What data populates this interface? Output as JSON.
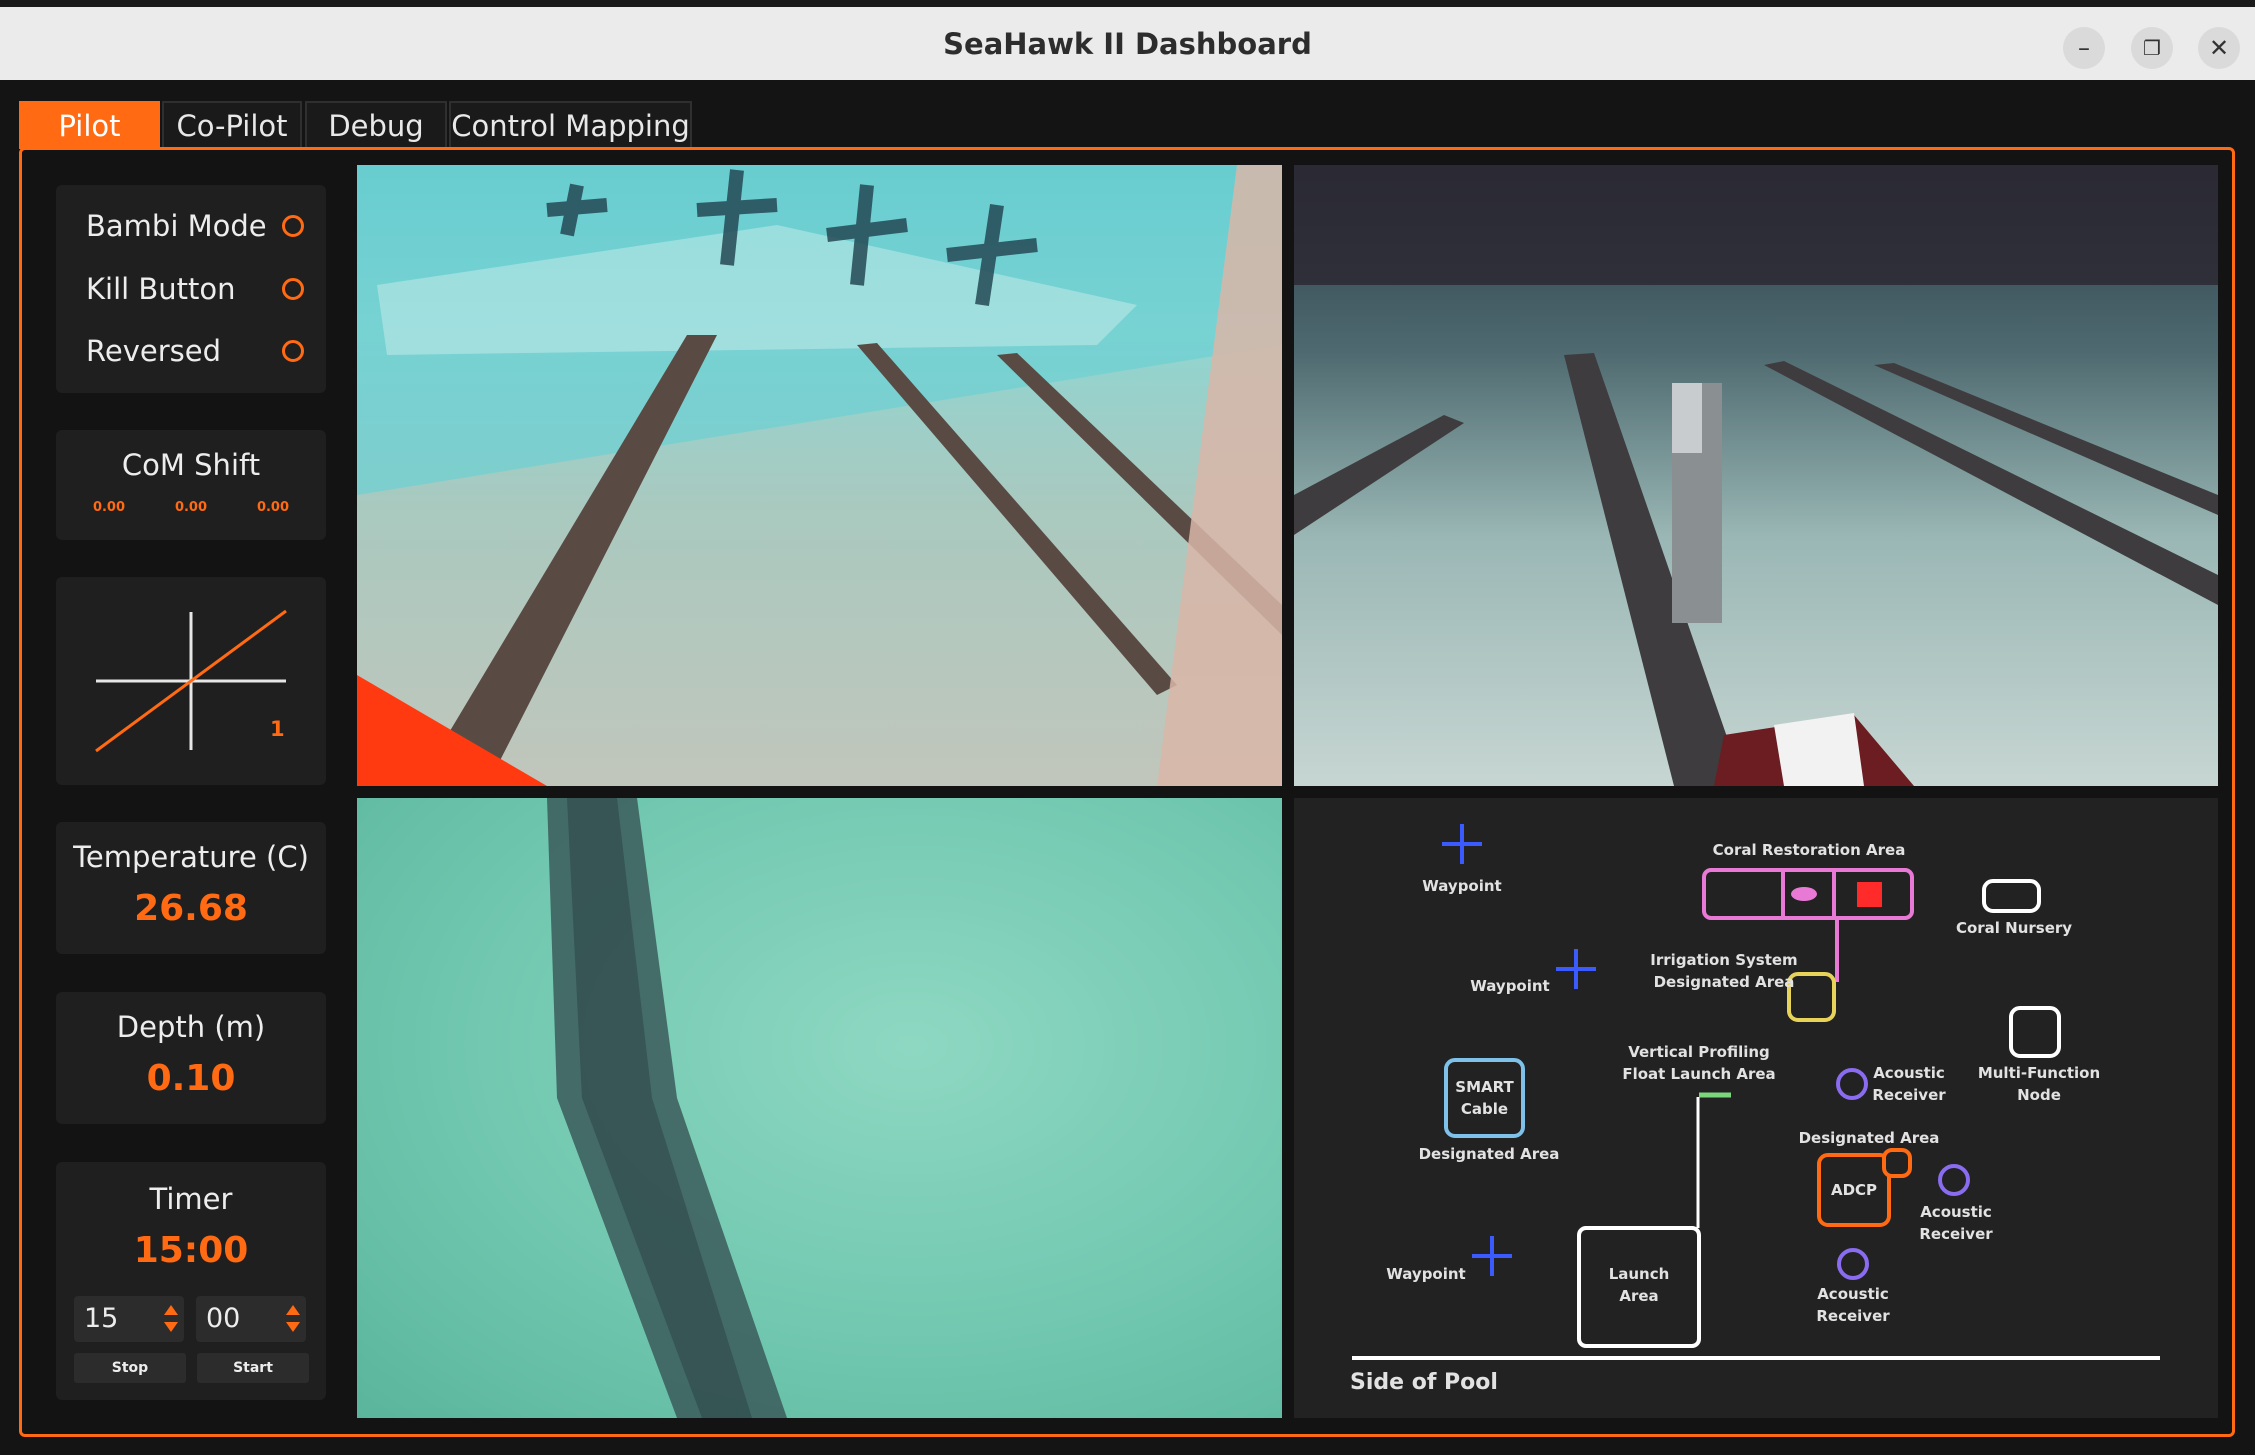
{
  "window": {
    "title": "SeaHawk II Dashboard"
  },
  "tabs": [
    {
      "label": "Pilot",
      "active": true
    },
    {
      "label": "Co-Pilot",
      "active": false
    },
    {
      "label": "Debug",
      "active": false
    },
    {
      "label": "Control Mapping",
      "active": false
    }
  ],
  "toggles": [
    {
      "label": "Bambi Mode",
      "on": false
    },
    {
      "label": "Kill Button",
      "on": false
    },
    {
      "label": "Reversed",
      "on": false
    }
  ],
  "com_shift": {
    "title": "CoM Shift",
    "values": [
      "0.00",
      "0.00",
      "0.00"
    ]
  },
  "control_curve": {
    "value": "1"
  },
  "temperature": {
    "title": "Temperature (C)",
    "value": "26.68"
  },
  "depth": {
    "title": "Depth (m)",
    "value": "0.10"
  },
  "timer": {
    "title": "Timer",
    "value": "15:00",
    "minutes": "15",
    "seconds": "00",
    "stop_label": "Stop",
    "start_label": "Start"
  },
  "map": {
    "coral_restoration": "Coral Restoration Area",
    "coral_nursery": "Coral Nursery",
    "waypoint": "Waypoint",
    "irrigation_line1": "Irrigation System",
    "irrigation_line2": "Designated Area",
    "vpf_line1": "Vertical Profiling",
    "vpf_line2": "Float Launch Area",
    "smart_line1": "SMART",
    "smart_line2": "Cable",
    "smart_area": "Designated Area",
    "acoustic_line1": "Acoustic",
    "acoustic_line2": "Receiver",
    "mfn_line1": "Multi-Function",
    "mfn_line2": "Node",
    "adcp_area": "Designated Area",
    "adcp": "ADCP",
    "launch_line1": "Launch",
    "launch_line2": "Area",
    "pool_side": "Side of Pool"
  },
  "colors": {
    "accent": "#ff6a12",
    "waypoint_blue": "#3b5bff",
    "coral_pink": "#e87ad6",
    "irrigation_yellow": "#e8d35a",
    "smart_blue": "#7ec2ea",
    "acoustic_purple": "#8a6cf0",
    "vpf_green": "#7cd67c"
  },
  "icons": {
    "minimize": "minimize-icon",
    "maximize": "maximize-icon",
    "close": "close-icon"
  }
}
